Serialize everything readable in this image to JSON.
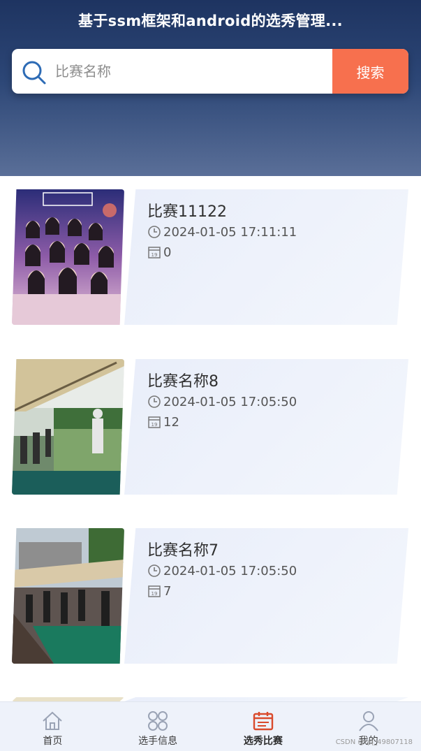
{
  "header": {
    "title": "基于ssm框架和android的选秀管理..."
  },
  "search": {
    "placeholder": "比赛名称",
    "button_label": "搜索"
  },
  "competitions": [
    {
      "title": "比赛11122",
      "time": "2024-01-05 17:11:11",
      "count": "0",
      "image": "idol-group-poster"
    },
    {
      "title": "比赛名称8",
      "time": "2024-01-05 17:05:50",
      "count": "12",
      "image": "golf-range-photo"
    },
    {
      "title": "比赛名称7",
      "time": "2024-01-05 17:05:50",
      "count": "7",
      "image": "golf-range-photo-2"
    }
  ],
  "nav": {
    "items": [
      {
        "label": "首页",
        "icon": "home-icon"
      },
      {
        "label": "选手信息",
        "icon": "grid-icon"
      },
      {
        "label": "选秀比赛",
        "icon": "calendar-icon",
        "active": true
      },
      {
        "label": "我的",
        "icon": "user-icon"
      }
    ]
  },
  "watermark": "CSDN @qq_49807118",
  "colors": {
    "header_top": "#1e3461",
    "header_bottom": "#5a6f98",
    "accent": "#f7704e",
    "active_nav": "#d94a2c"
  }
}
